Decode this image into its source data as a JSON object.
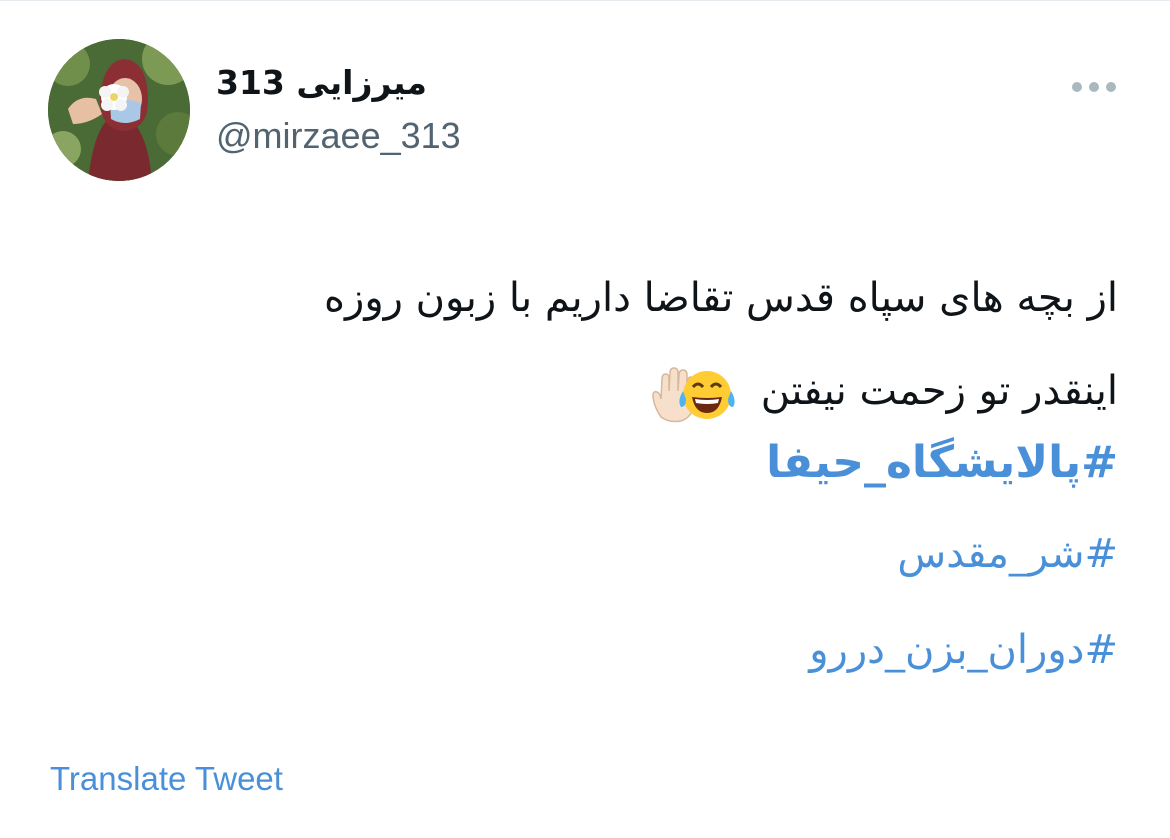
{
  "tweet": {
    "author": {
      "display_name": "میرزایی 313",
      "handle": "@mirzaee_313",
      "avatar_icon": "profile-photo-woman-with-flower"
    },
    "more_icon": "more-horizontal-icon",
    "text_lines": [
      "از بچه های سپاه قدس تقاضا داریم با زبون روزه",
      "اینقدر تو زحمت نیفتن"
    ],
    "emojis": [
      "face-with-tears-of-joy-icon",
      "raised-hand-icon"
    ],
    "hashtags": [
      "#پالایشگاه_حیفا",
      "#شر_مقدس",
      "#دوران_بزن_دررو"
    ],
    "translate_label": "Translate Tweet",
    "colors": {
      "link": "#4a90d9",
      "text": "#0f1419",
      "secondary_text": "#536471",
      "more_dots": "#aab8c2"
    }
  }
}
